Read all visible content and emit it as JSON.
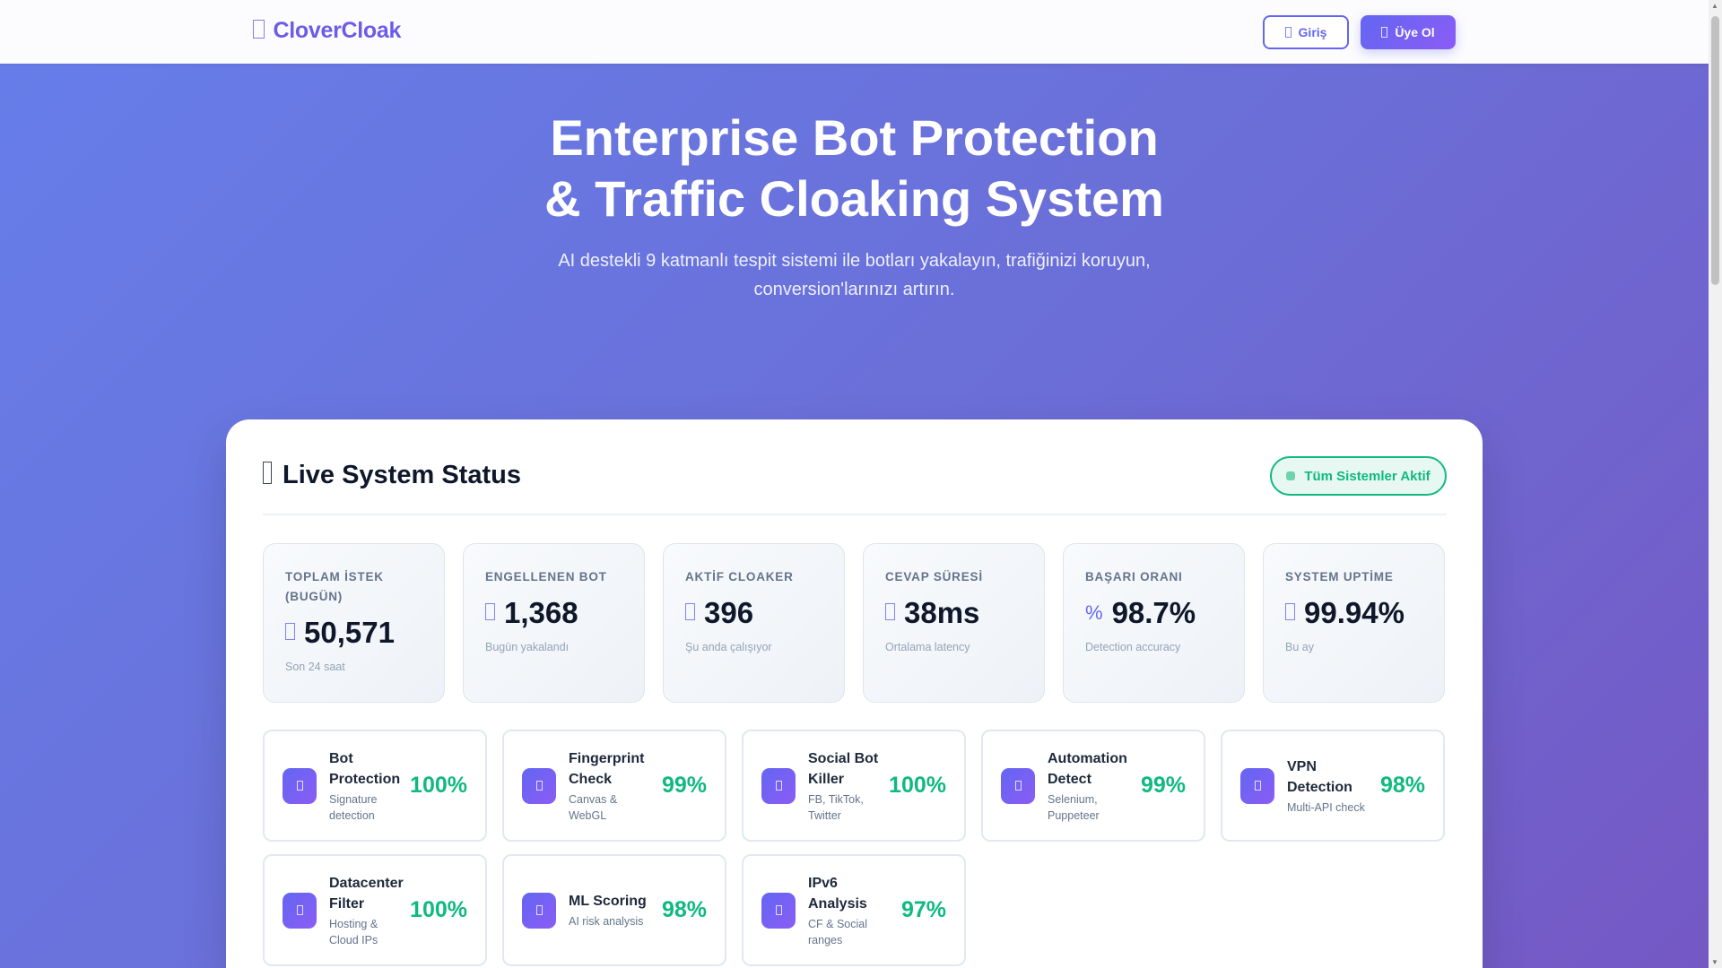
{
  "nav": {
    "logo": "CloverCloak",
    "login": "Giriş",
    "signup": "Üye Ol"
  },
  "hero": {
    "title_line1": "Enterprise Bot Protection",
    "title_line2": "& Traffic Cloaking System",
    "subtitle_line1": "AI destekli 9 katmanlı tespit sistemi ile botları yakalayın, trafiğinizi koruyun,",
    "subtitle_line2": "conversion'larınızı artırın."
  },
  "status": {
    "title": "Live System Status",
    "badge": "Tüm Sistemler Aktif",
    "stats": [
      {
        "label": "TOPLAM İSTEK (BUGÜN)",
        "value": "50,571",
        "sub": "Son 24 saat",
        "icon": ""
      },
      {
        "label": "ENGELLENEN BOT",
        "value": "1,368",
        "sub": "Bugün yakalandı",
        "icon": ""
      },
      {
        "label": "AKTİF CLOAKER",
        "value": "396",
        "sub": "Şu anda çalışıyor",
        "icon": ""
      },
      {
        "label": "CEVAP SÜRESİ",
        "value": "38ms",
        "sub": "Ortalama latency",
        "icon": ""
      },
      {
        "label": "BAŞARI ORANI",
        "value": "98.7%",
        "sub": "Detection accuracy",
        "icon": "%"
      },
      {
        "label": "SYSTEM UPTİME",
        "value": "99.94%",
        "sub": "Bu ay",
        "icon": ""
      }
    ],
    "features": [
      {
        "title": "Bot Protection",
        "sub": "Signature detection",
        "pct": "100%"
      },
      {
        "title": "Fingerprint Check",
        "sub": "Canvas & WebGL",
        "pct": "99%"
      },
      {
        "title": "Social Bot Killer",
        "sub": "FB, TikTok, Twitter",
        "pct": "100%"
      },
      {
        "title": "Automation Detect",
        "sub": "Selenium, Puppeteer",
        "pct": "99%"
      },
      {
        "title": "VPN Detection",
        "sub": "Multi-API check",
        "pct": "98%"
      },
      {
        "title": "Datacenter Filter",
        "sub": "Hosting & Cloud IPs",
        "pct": "100%"
      },
      {
        "title": "ML Scoring",
        "sub": "AI risk analysis",
        "pct": "98%"
      },
      {
        "title": "IPv6 Analysis",
        "sub": "CF & Social ranges",
        "pct": "97%"
      }
    ]
  }
}
